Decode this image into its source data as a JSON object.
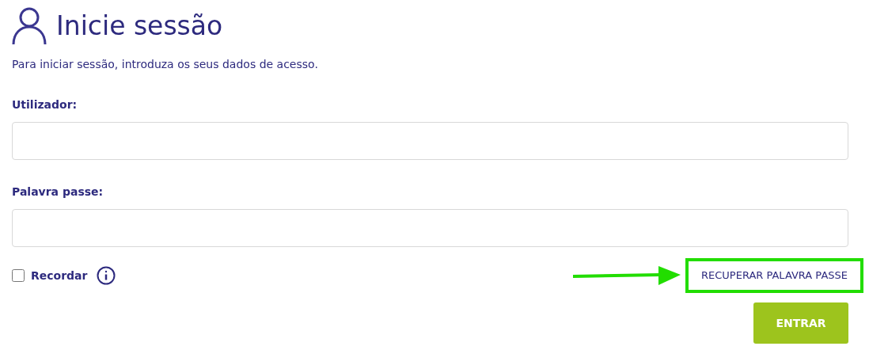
{
  "title": "Inicie sessão",
  "intro": "Para iniciar sessão, introduza os seus dados de acesso.",
  "fields": [
    {
      "label": "Utilizador:"
    },
    {
      "label": "Palavra passe:"
    }
  ],
  "remember": {
    "label": "Recordar",
    "checked": false
  },
  "recover_link": {
    "label": "RECUPERAR PALAVRA PASSE",
    "highlighted": true
  },
  "submit": "ENTRAR"
}
